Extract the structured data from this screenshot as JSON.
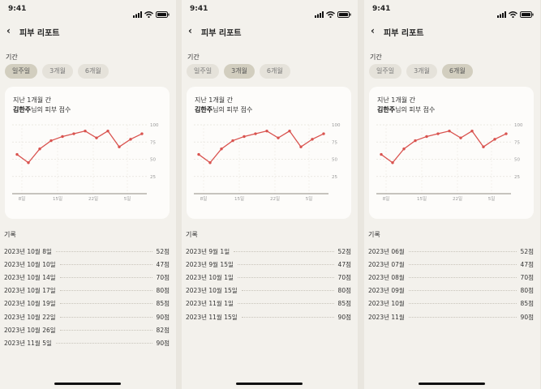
{
  "status": {
    "time": "9:41"
  },
  "header": {
    "back": "‹",
    "title": "피부 리포트"
  },
  "period_label": "기간",
  "records_label": "기록",
  "icons": {
    "signal": "signal-icon",
    "wifi": "wifi-icon",
    "battery": "battery-icon",
    "back": "chevron-left-icon"
  },
  "colors": {
    "line": "#d9534f",
    "active_chip": "#d2cebf"
  },
  "screens": [
    {
      "tabs": [
        {
          "label": "일주일",
          "active": true
        },
        {
          "label": "3개월",
          "active": false
        },
        {
          "label": "6개월",
          "active": false
        }
      ],
      "card": {
        "line1": "지난 1개월 간",
        "name": "김한주",
        "suffix": "님의 피부 점수"
      },
      "records": [
        {
          "date": "2023년 10월 8일",
          "score": "52점"
        },
        {
          "date": "2023년 10월 10일",
          "score": "47점"
        },
        {
          "date": "2023년 10월 14일",
          "score": "70점"
        },
        {
          "date": "2023년 10월 17일",
          "score": "80점"
        },
        {
          "date": "2023년 10월 19일",
          "score": "85점"
        },
        {
          "date": "2023년 10월 22일",
          "score": "90점"
        },
        {
          "date": "2023년 10월 26일",
          "score": "82점"
        },
        {
          "date": "2023년 11월 5일",
          "score": "90점"
        }
      ]
    },
    {
      "tabs": [
        {
          "label": "일주일",
          "active": false
        },
        {
          "label": "3개월",
          "active": true
        },
        {
          "label": "6개월",
          "active": false
        }
      ],
      "card": {
        "line1": "지난 1개월 간",
        "name": "김한주",
        "suffix": "님의 피부 점수"
      },
      "records": [
        {
          "date": "2023년 9월 1일",
          "score": "52점"
        },
        {
          "date": "2023년 9월 15일",
          "score": "47점"
        },
        {
          "date": "2023년 10월 1일",
          "score": "70점"
        },
        {
          "date": "2023년 10월 15일",
          "score": "80점"
        },
        {
          "date": "2023년 11월 1일",
          "score": "85점"
        },
        {
          "date": "2023년 11월 15일",
          "score": "90점"
        }
      ]
    },
    {
      "tabs": [
        {
          "label": "일주일",
          "active": false
        },
        {
          "label": "3개월",
          "active": false
        },
        {
          "label": "6개월",
          "active": true
        }
      ],
      "card": {
        "line1": "지난 1개월 간",
        "name": "김한주",
        "suffix": "님의 피부 점수"
      },
      "records": [
        {
          "date": "2023년 06월",
          "score": "52점"
        },
        {
          "date": "2023년 07월",
          "score": "47점"
        },
        {
          "date": "2023년 08월",
          "score": "70점"
        },
        {
          "date": "2023년 09월",
          "score": "80점"
        },
        {
          "date": "2023년 10월",
          "score": "85점"
        },
        {
          "date": "2023년 11월",
          "score": "90점"
        }
      ]
    }
  ],
  "chart_data": [
    {
      "type": "line",
      "y_ticks": [
        "100",
        "75",
        "50",
        "25"
      ],
      "ylim": [
        0,
        100
      ],
      "x_ticks": [
        "8일",
        "15일",
        "22일",
        "5일"
      ],
      "values": [
        57,
        45,
        65,
        77,
        83,
        87,
        91,
        81,
        91,
        68,
        79,
        87
      ],
      "grid": true
    },
    {
      "type": "line",
      "y_ticks": [
        "100",
        "75",
        "50",
        "25"
      ],
      "ylim": [
        0,
        100
      ],
      "x_ticks": [
        "8일",
        "15일",
        "22일",
        "5일"
      ],
      "values": [
        57,
        45,
        65,
        77,
        83,
        87,
        91,
        81,
        91,
        68,
        79,
        87
      ],
      "grid": true
    },
    {
      "type": "line",
      "y_ticks": [
        "100",
        "75",
        "50",
        "25"
      ],
      "ylim": [
        0,
        100
      ],
      "x_ticks": [
        "8일",
        "15일",
        "22일",
        "5일"
      ],
      "values": [
        57,
        45,
        65,
        77,
        83,
        87,
        91,
        81,
        91,
        68,
        79,
        87
      ],
      "grid": true
    }
  ]
}
